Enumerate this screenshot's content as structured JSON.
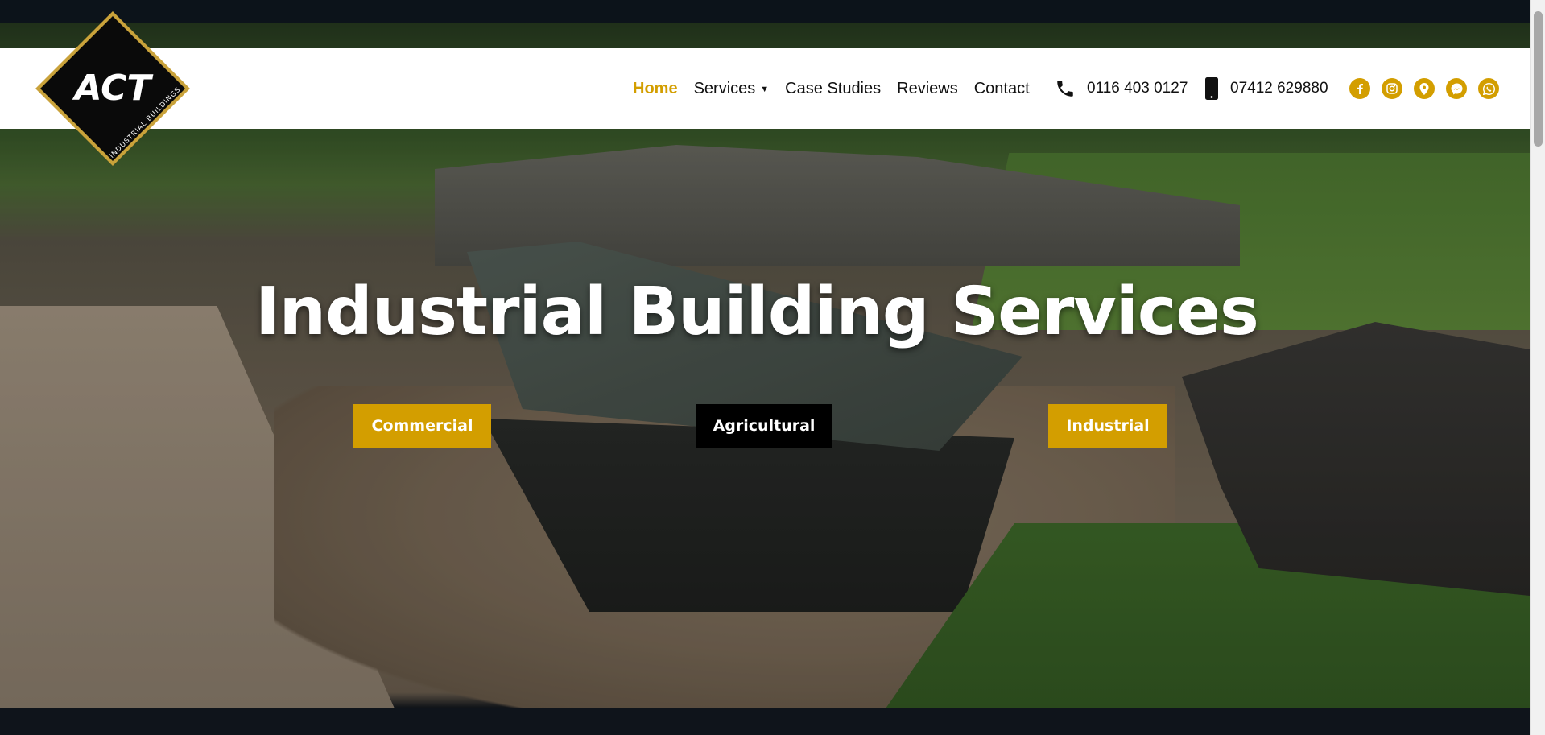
{
  "brand": {
    "logo_text": "ACT",
    "logo_subtext": "INDUSTRIAL BUILDINGS",
    "accent_color": "#d39e00"
  },
  "nav": {
    "items": [
      {
        "label": "Home",
        "active": true
      },
      {
        "label": "Services",
        "has_dropdown": true
      },
      {
        "label": "Case Studies"
      },
      {
        "label": "Reviews"
      },
      {
        "label": "Contact"
      }
    ],
    "dropdown_caret": "▼"
  },
  "contacts": {
    "landline": {
      "icon": "phone-icon",
      "number": "0116 403 0127"
    },
    "mobile": {
      "icon": "mobile-phone-icon",
      "number": "07412 629880"
    }
  },
  "socials": [
    {
      "icon": "facebook-icon"
    },
    {
      "icon": "instagram-icon"
    },
    {
      "icon": "map-pin-icon"
    },
    {
      "icon": "messenger-icon"
    },
    {
      "icon": "whatsapp-icon"
    }
  ],
  "hero": {
    "title": "Industrial Building Services",
    "buttons": [
      {
        "label": "Commercial",
        "style": "gold"
      },
      {
        "label": "Agricultural",
        "style": "black"
      },
      {
        "label": "Industrial",
        "style": "gold"
      }
    ]
  }
}
